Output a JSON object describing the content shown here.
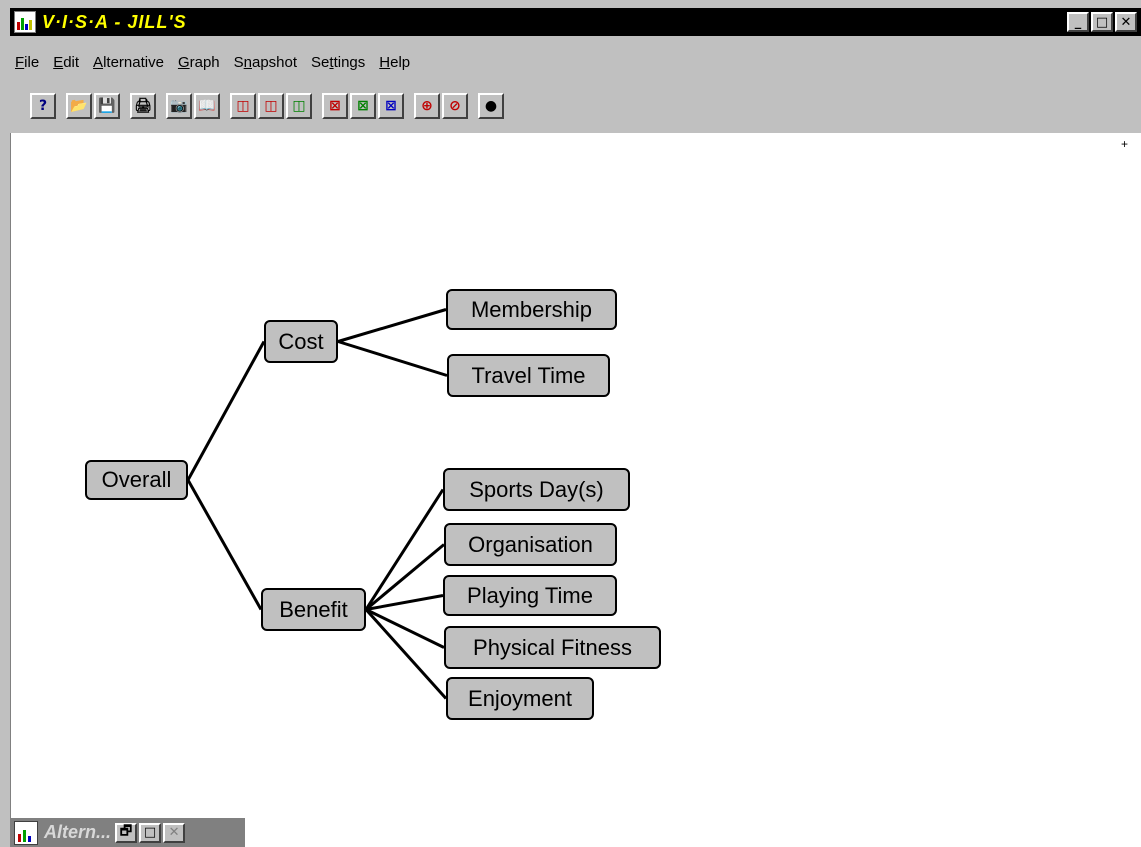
{
  "window": {
    "title": "V·I·S·A - JILL'S",
    "buttons": {
      "minimize": "_",
      "maximize": "□",
      "close": "✕"
    }
  },
  "menu": [
    {
      "label": "File",
      "key": "F"
    },
    {
      "label": "Edit",
      "key": "E"
    },
    {
      "label": "Alternative",
      "key": "A"
    },
    {
      "label": "Graph",
      "key": "G"
    },
    {
      "label": "Snapshot",
      "key": "n"
    },
    {
      "label": "Settings",
      "key": "t"
    },
    {
      "label": "Help",
      "key": "H"
    }
  ],
  "toolbar": [
    {
      "name": "help-icon",
      "glyph": "?",
      "color": "#000080"
    },
    {
      "name": "open-folder-icon",
      "glyph": "📂",
      "color": "#a08000"
    },
    {
      "name": "save-disk-icon",
      "glyph": "💾",
      "color": "#000080"
    },
    {
      "name": "print-icon",
      "glyph": "🖨",
      "color": "#000"
    },
    {
      "name": "camera-icon",
      "glyph": "📷",
      "color": "#000"
    },
    {
      "name": "album-icon",
      "glyph": "📖",
      "color": "#000"
    },
    {
      "name": "chart-view-1-icon",
      "glyph": "◫",
      "color": "#c00000"
    },
    {
      "name": "chart-view-2-icon",
      "glyph": "◫",
      "color": "#c00000"
    },
    {
      "name": "chart-view-3-icon",
      "glyph": "◫",
      "color": "#008000"
    },
    {
      "name": "line-graph-1-icon",
      "glyph": "⊠",
      "color": "#c00000"
    },
    {
      "name": "line-graph-2-icon",
      "glyph": "⊠",
      "color": "#008000"
    },
    {
      "name": "line-graph-3-icon",
      "glyph": "⊠",
      "color": "#0000c0"
    },
    {
      "name": "zoom-in-icon",
      "glyph": "⊕",
      "color": "#c00000"
    },
    {
      "name": "zoom-out-icon",
      "glyph": "⊘",
      "color": "#c00000"
    },
    {
      "name": "bomb-icon",
      "glyph": "●",
      "color": "#000"
    }
  ],
  "tree": {
    "nodes": [
      {
        "id": "overall",
        "label": "Overall"
      },
      {
        "id": "cost",
        "label": "Cost"
      },
      {
        "id": "benefit",
        "label": "Benefit"
      },
      {
        "id": "membership",
        "label": "Membership"
      },
      {
        "id": "travel",
        "label": "Travel Time"
      },
      {
        "id": "sports",
        "label": "Sports Day(s)"
      },
      {
        "id": "organisation",
        "label": "Organisation"
      },
      {
        "id": "playing",
        "label": "Playing Time"
      },
      {
        "id": "fitness",
        "label": "Physical Fitness"
      },
      {
        "id": "enjoyment",
        "label": "Enjoyment"
      }
    ]
  },
  "canvas_marker": "+",
  "minimized_window": {
    "title": "Altern..."
  }
}
